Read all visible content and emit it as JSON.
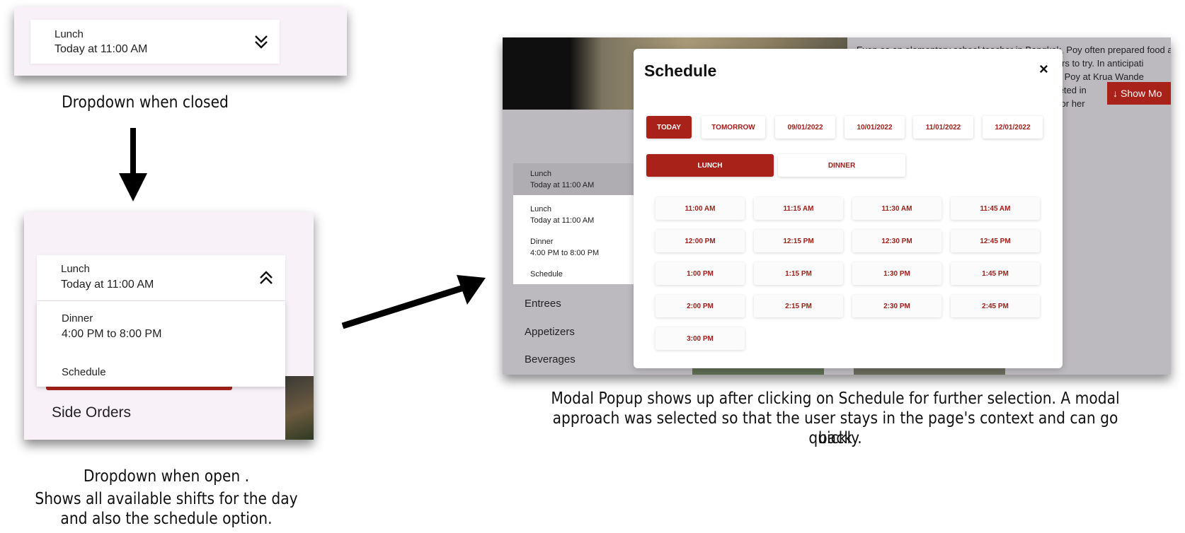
{
  "closed_dropdown": {
    "title": "Lunch",
    "subtitle": "Today at 11:00 AM"
  },
  "open_dropdown": {
    "selected": {
      "title": "Lunch",
      "subtitle": "Today at 11:00 AM"
    },
    "options": [
      {
        "title": "Dinner",
        "subtitle": "4:00 PM to 8:00 PM"
      },
      {
        "title": "Schedule"
      }
    ],
    "background_category": "Side Orders"
  },
  "page": {
    "article_text": [
      "Even as an elementary school teacher in Bangkok, Poy often prepared food at",
      "-workers to try. In anticipati",
      "nrolled Poy at Krua Wande",
      "completed in",
      "lwork for her"
    ],
    "show_more_label": "Show Mo",
    "dropdown_selected": {
      "title": "Lunch",
      "subtitle": "Today at 11:00 AM"
    },
    "dropdown_options": [
      {
        "title": "Lunch",
        "subtitle": "Today at 11:00 AM"
      },
      {
        "title": "Dinner",
        "subtitle": "4:00 PM to 8:00 PM"
      },
      {
        "title": "Schedule"
      }
    ],
    "categories": [
      "Entrees",
      "Appetizers",
      "Beverages"
    ]
  },
  "modal": {
    "title": "Schedule",
    "close_glyph": "×",
    "date_tabs": [
      "TODAY",
      "TOMORROW",
      "09/01/2022",
      "10/01/2022",
      "11/01/2022",
      "12/01/2022"
    ],
    "active_date": "TODAY",
    "shift_tabs": [
      "LUNCH",
      "DINNER"
    ],
    "active_shift": "LUNCH",
    "time_slots": [
      "11:00 AM",
      "11:15 AM",
      "11:30 AM",
      "11:45 AM",
      "12:00 PM",
      "12:15 PM",
      "12:30 PM",
      "12:45 PM",
      "1:00 PM",
      "1:15 PM",
      "1:30 PM",
      "1:45 PM",
      "2:00 PM",
      "2:15 PM",
      "2:30 PM",
      "2:45 PM",
      "3:00 PM"
    ]
  },
  "captions": {
    "closed": "Dropdown when closed",
    "open_line1": "Dropdown when open .",
    "open_line2": "Shows all available shifts for the day",
    "open_line3": "and also the schedule option.",
    "modal_line1": "Modal Popup shows up after clicking on Schedule for further selection. A modal",
    "modal_line2": "approach was selected so that the user stays in the page's context and can go back",
    "modal_line3": "quickly."
  },
  "colors": {
    "accent": "#a8221a",
    "panel_bg": "#f8f1f8",
    "overlay": "#bdbabf"
  },
  "icons": [
    "chevron-double-down-icon",
    "chevron-double-up-icon",
    "close-icon",
    "arrow-down-icon"
  ]
}
